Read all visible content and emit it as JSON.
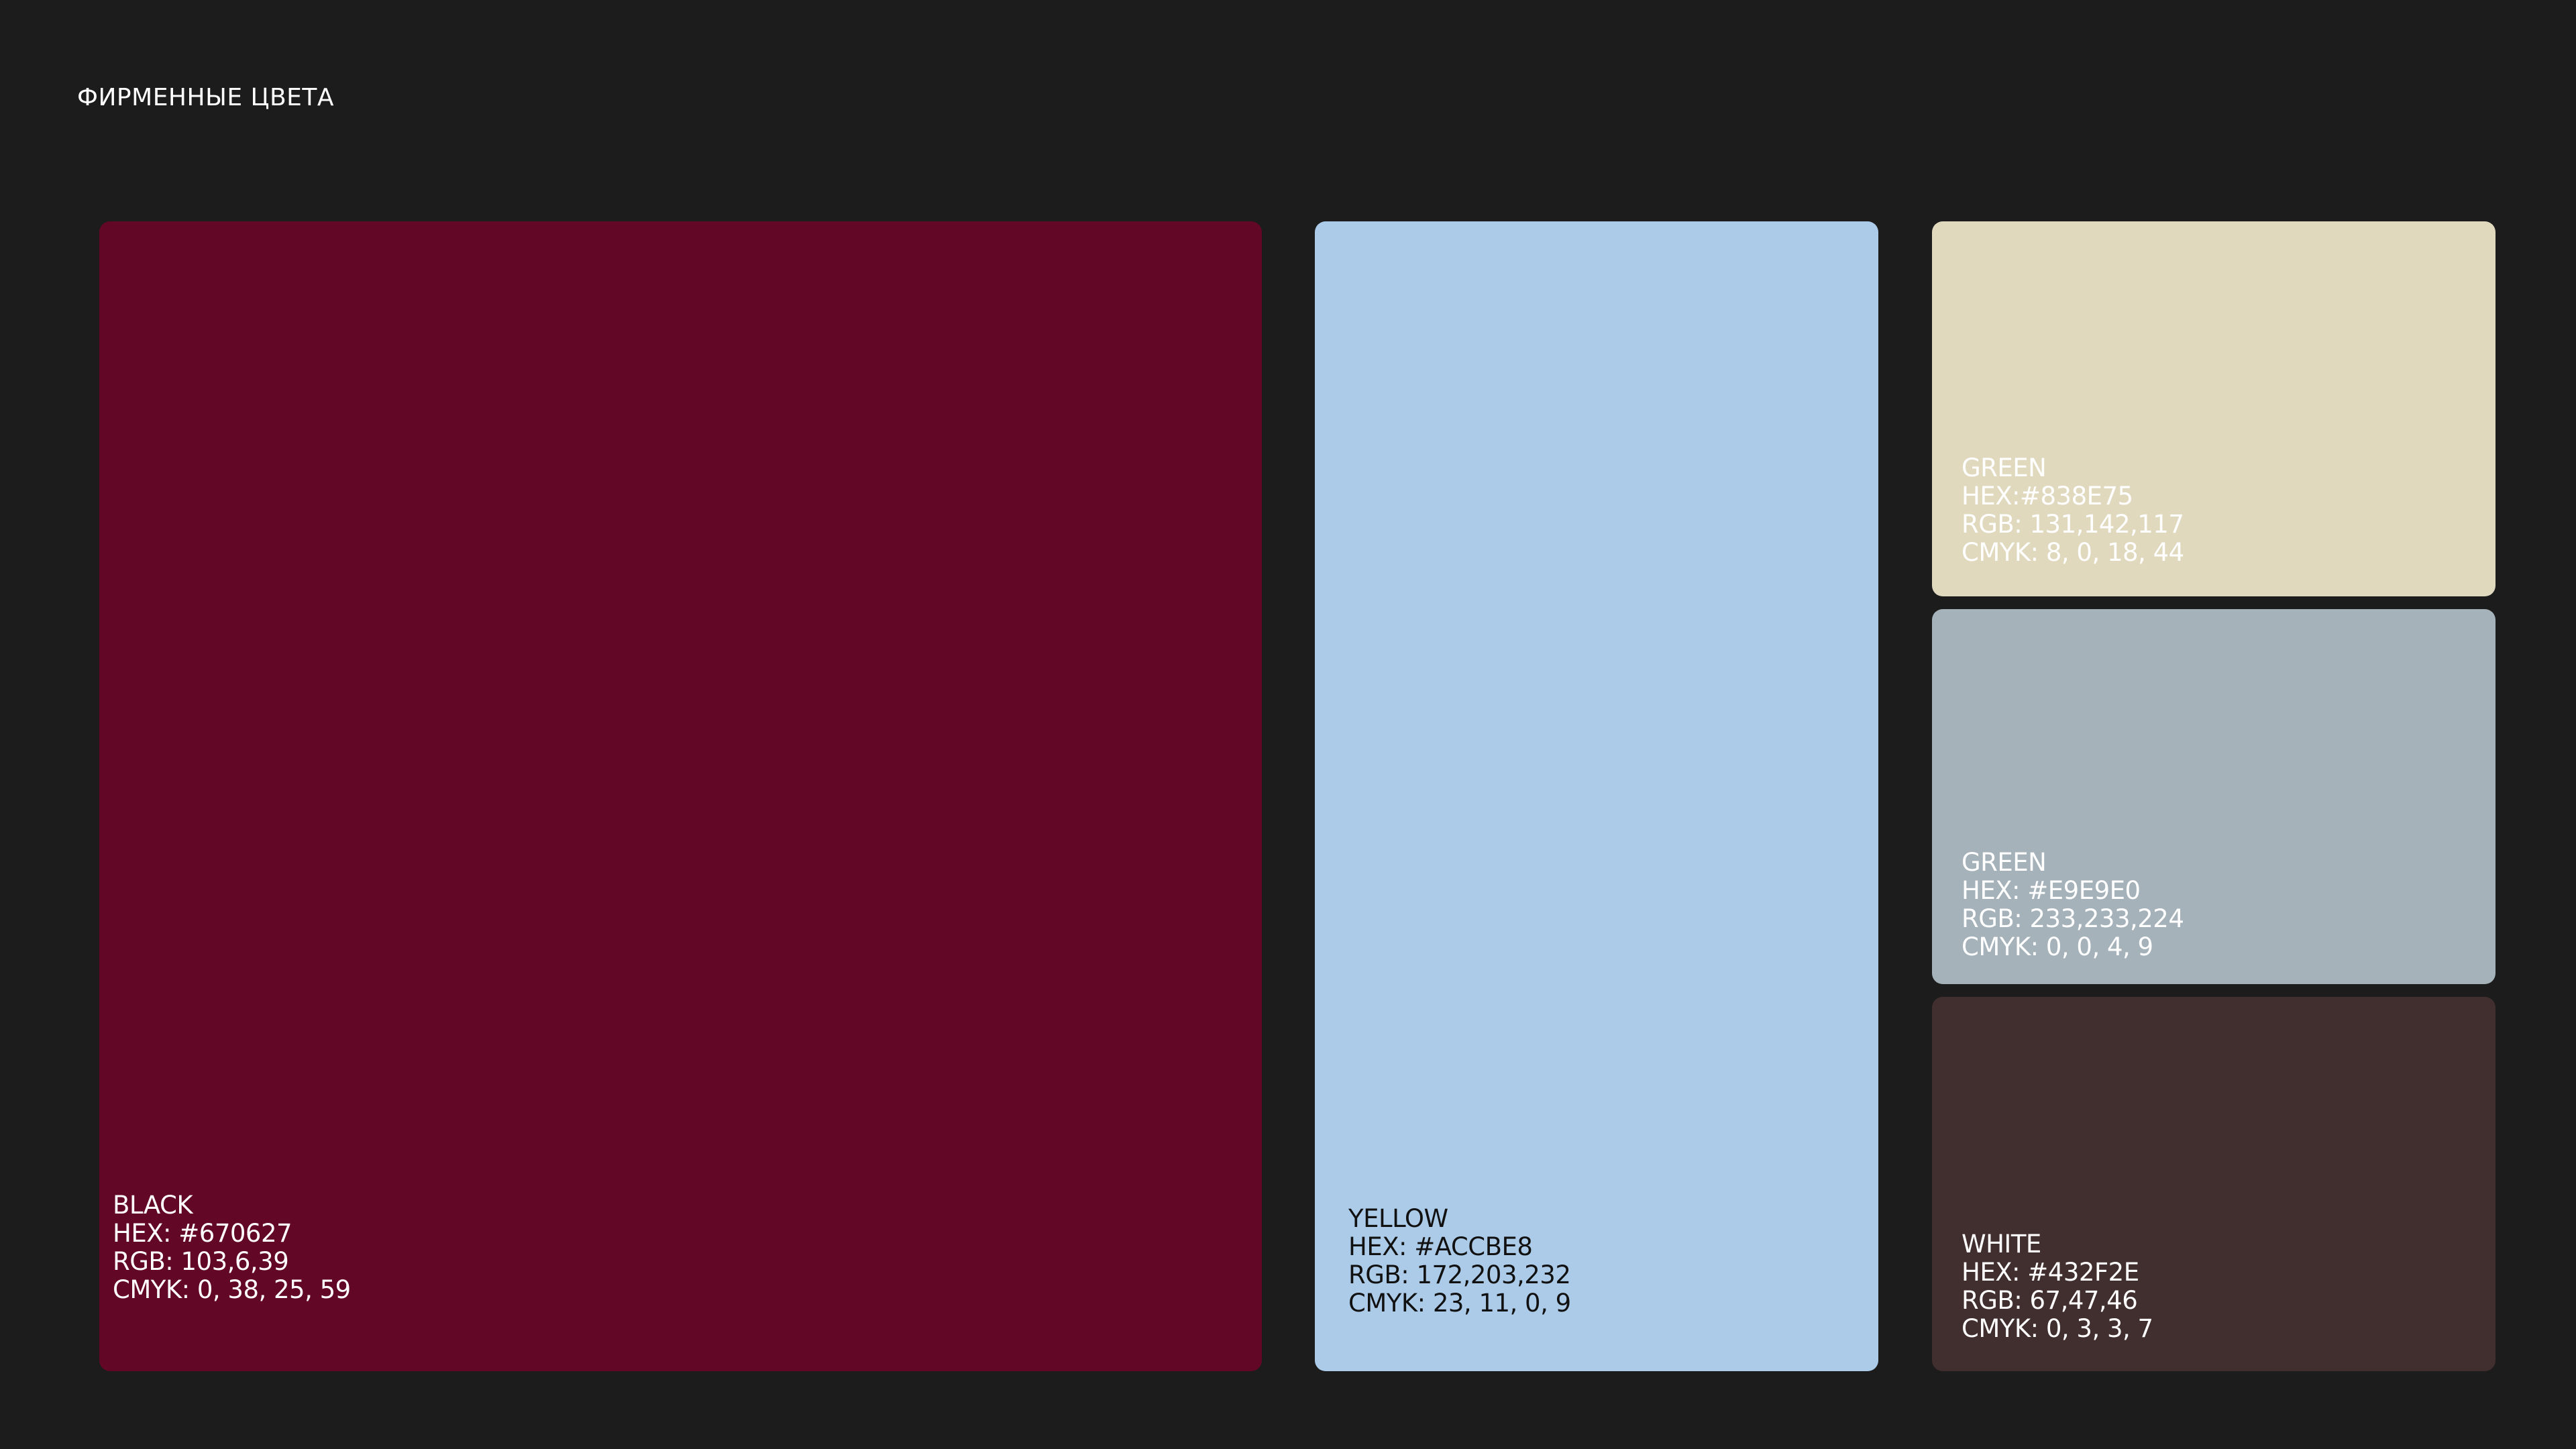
{
  "page": {
    "title": "ФИРМЕННЫЕ ЦВЕТА",
    "background_color": "#1c1c1d"
  },
  "swatches": [
    {
      "id": "black",
      "color": "#620726",
      "text_color": "#ffffff",
      "name": "BLACK",
      "hex": "HEX: #670627",
      "rgb": "RGB: 103,6,39",
      "cmyk": "CMYK: 0, 38, 25, 59"
    },
    {
      "id": "yellow",
      "color": "#accbe8",
      "text_color": "#111111",
      "name": "YELLOW",
      "hex": "HEX: #ACCBE8",
      "rgb": "RGB: 172,203,232",
      "cmyk": "CMYK: 23, 11, 0, 9"
    },
    {
      "id": "green1",
      "color": "#e0d9be",
      "text_color": "#ffffff",
      "name": "GREEN",
      "hex": "HEX:#838E75",
      "rgb": "RGB: 131,142,117",
      "cmyk": "CMYK: 8, 0, 18, 44"
    },
    {
      "id": "green2",
      "color": "#a5b2ba",
      "text_color": "#ffffff",
      "name": "GREEN",
      "hex": "HEX: #E9E9E0",
      "rgb": "RGB: 233,233,224",
      "cmyk": "CMYK: 0, 0, 4, 9"
    },
    {
      "id": "white",
      "color": "#412e2e",
      "text_color": "#ffffff",
      "name": "WHITE",
      "hex": "HEX: #432F2E",
      "rgb": "RGB: 67,47,46",
      "cmyk": "CMYK: 0, 3, 3, 7"
    }
  ]
}
